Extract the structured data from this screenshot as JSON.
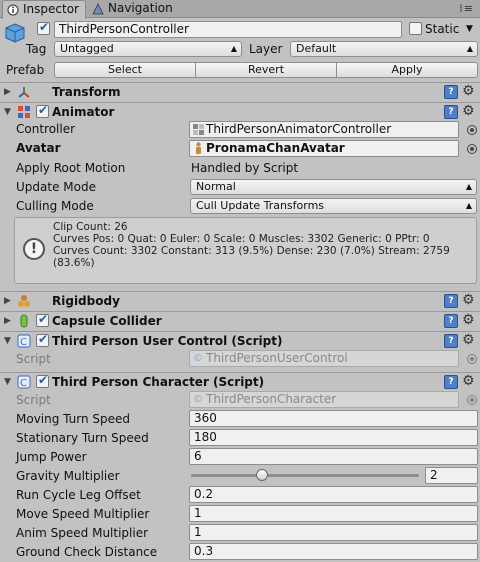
{
  "tabs": [
    {
      "label": "Inspector",
      "icon": "info-icon",
      "active": true
    },
    {
      "label": "Navigation",
      "icon": "navigation-icon",
      "active": false
    }
  ],
  "object": {
    "name": "ThirdPersonController",
    "static_label": "Static",
    "tag_label": "Tag",
    "tag_value": "Untagged",
    "layer_label": "Layer",
    "layer_value": "Default",
    "prefab_label": "Prefab",
    "select_label": "Select",
    "revert_label": "Revert",
    "apply_label": "Apply"
  },
  "transform": {
    "title": "Transform"
  },
  "animator": {
    "title": "Animator",
    "controller_label": "Controller",
    "controller_value": "ThirdPersonAnimatorController",
    "avatar_label": "Avatar",
    "avatar_value": "PronamaChanAvatar",
    "root_motion_label": "Apply Root Motion",
    "root_motion_value": "Handled by Script",
    "update_mode_label": "Update Mode",
    "update_mode_value": "Normal",
    "culling_mode_label": "Culling Mode",
    "culling_mode_value": "Cull Update Transforms",
    "info_lines": [
      "Clip Count: 26",
      "Curves Pos: 0 Quat: 0 Euler: 0 Scale: 0 Muscles: 3302 Generic: 0 PPtr: 0",
      "Curves Count: 3302 Constant: 313 (9.5%) Dense: 230 (7.0%) Stream: 2759",
      "(83.6%)"
    ]
  },
  "rigidbody": {
    "title": "Rigidbody"
  },
  "capsule": {
    "title": "Capsule Collider"
  },
  "user_control": {
    "title": "Third Person User Control (Script)",
    "script_label": "Script",
    "script_value": "ThirdPersonUserControl"
  },
  "character": {
    "title": "Third Person Character (Script)",
    "script_label": "Script",
    "script_value": "ThirdPersonCharacter",
    "fields": [
      {
        "label": "Moving Turn Speed",
        "value": "360"
      },
      {
        "label": "Stationary Turn Speed",
        "value": "180"
      },
      {
        "label": "Jump Power",
        "value": "6"
      },
      {
        "label": "Gravity Multiplier",
        "value": "2"
      },
      {
        "label": "Run Cycle Leg Offset",
        "value": "0.2"
      },
      {
        "label": "Move Speed Multiplier",
        "value": "1"
      },
      {
        "label": "Anim Speed Multiplier",
        "value": "1"
      },
      {
        "label": "Ground Check Distance",
        "value": "0.3"
      }
    ],
    "gravity_slider_fraction": 0.31
  },
  "colors": {
    "help_icon": "#4f7fc6",
    "check": "#1c5fb5",
    "background": "#c2c2c2"
  }
}
